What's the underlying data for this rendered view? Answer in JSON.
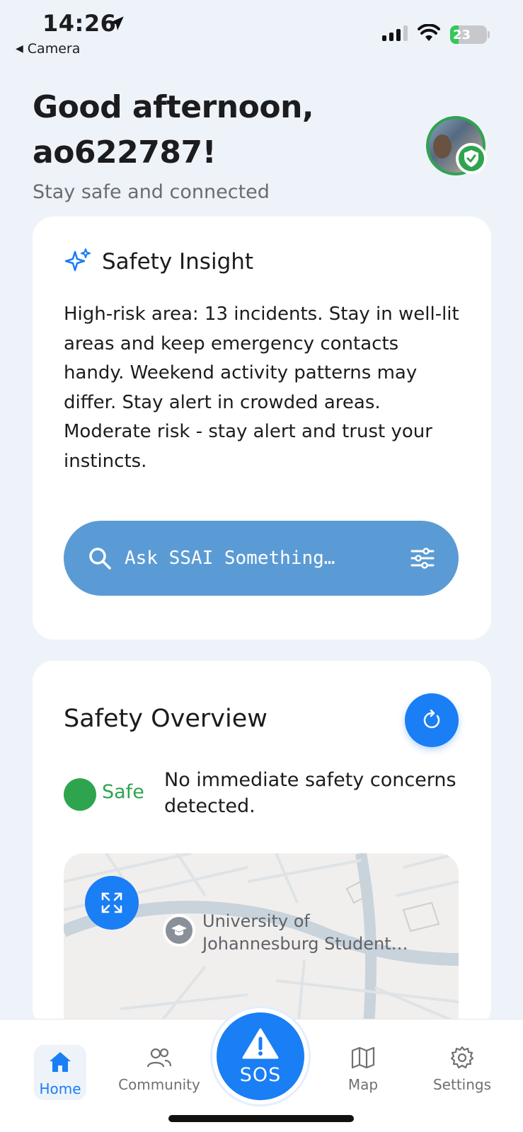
{
  "status_bar": {
    "time": "14:26",
    "back_label": "Camera",
    "battery": "23",
    "battery_level": 0.23
  },
  "header": {
    "greeting_line1": "Good afternoon,",
    "greeting_line2": "ao622787!",
    "subtitle": "Stay safe and connected"
  },
  "insight": {
    "title": "Safety Insight",
    "body": "High-risk area: 13 incidents. Stay in well-lit areas and keep emergency contacts handy. Weekend activity patterns may differ. Stay alert in crowded areas. Moderate risk - stay alert and trust your instincts.",
    "ask_placeholder": "Ask SSAI Something…"
  },
  "overview": {
    "title": "Safety Overview",
    "status_word": "Safe",
    "status_description": "No immediate safety concerns detected.",
    "map_poi_line1": "University of",
    "map_poi_line2": "Johannesburg Student…"
  },
  "tabs": {
    "home": "Home",
    "community": "Community",
    "sos": "SOS",
    "map": "Map",
    "settings": "Settings"
  },
  "colors": {
    "accent": "#1a7ef5",
    "ask_bar": "#5b9bd5",
    "safe": "#2ea44f"
  }
}
